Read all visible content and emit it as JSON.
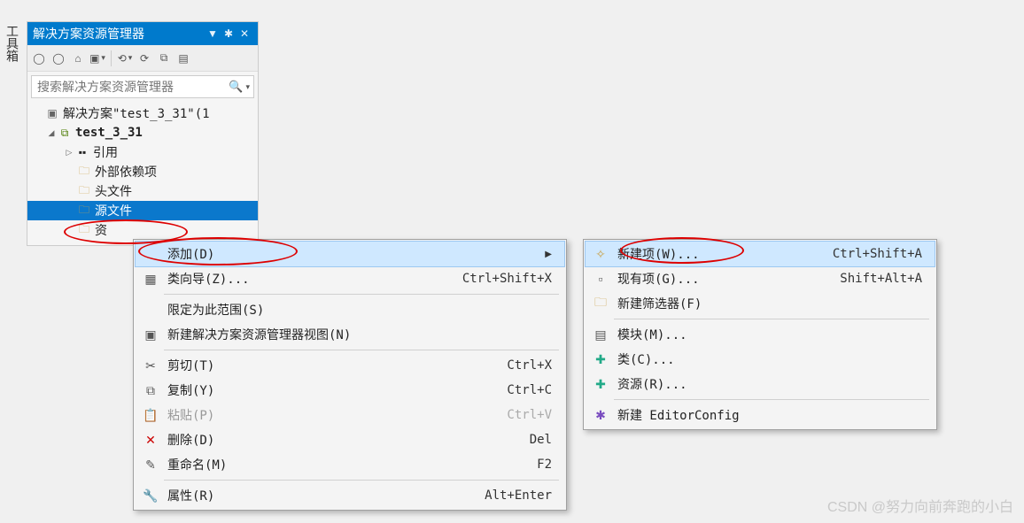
{
  "vertical_tab": "工具箱",
  "panel": {
    "title": "解决方案资源管理器",
    "window_buttons": {
      "dropdown": "▼",
      "pin": "📌",
      "close": "✕"
    },
    "search_placeholder": "搜索解决方案资源管理器"
  },
  "tree": {
    "solution": "解决方案\"test_3_31\"(1",
    "project": "test_3_31",
    "references": "引用",
    "external": "外部依赖项",
    "headers": "头文件",
    "sources": "源文件",
    "res_short": "资"
  },
  "ctx": {
    "add": "添加(D)",
    "classwizard": "类向导(Z)...",
    "classwizard_sc": "Ctrl+Shift+X",
    "scope": "限定为此范围(S)",
    "newview": "新建解决方案资源管理器视图(N)",
    "cut": "剪切(T)",
    "cut_sc": "Ctrl+X",
    "copy": "复制(Y)",
    "copy_sc": "Ctrl+C",
    "paste": "粘贴(P)",
    "paste_sc": "Ctrl+V",
    "delete": "删除(D)",
    "delete_sc": "Del",
    "rename": "重命名(M)",
    "rename_sc": "F2",
    "props": "属性(R)",
    "props_sc": "Alt+Enter"
  },
  "sub": {
    "newitem": "新建项(W)...",
    "newitem_sc": "Ctrl+Shift+A",
    "existing": "现有项(G)...",
    "existing_sc": "Shift+Alt+A",
    "newfilter": "新建筛选器(F)",
    "module": "模块(M)...",
    "class": "类(C)...",
    "resource": "资源(R)...",
    "editorconfig": "新建 EditorConfig"
  },
  "watermark": "CSDN @努力向前奔跑的小白"
}
